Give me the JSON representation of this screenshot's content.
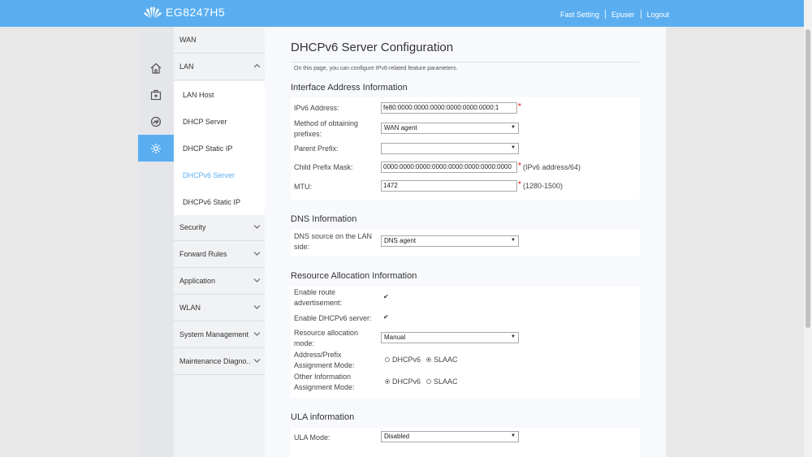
{
  "header": {
    "product": "EG8247H5",
    "fast_setting": "Fast Setting",
    "user": "Epuser",
    "logout": "Logout"
  },
  "sidebar": {
    "icons": [
      "home-icon",
      "medkit-icon",
      "gauge-icon",
      "gear-icon"
    ],
    "menu": [
      {
        "label": "WAN"
      },
      {
        "label": "LAN"
      },
      {
        "label": "Security"
      },
      {
        "label": "Forward Rules"
      },
      {
        "label": "Application"
      },
      {
        "label": "WLAN"
      },
      {
        "label": "System Management"
      },
      {
        "label": "Maintenance Diagno.."
      }
    ],
    "lan_submenu": [
      "LAN Host",
      "DHCP Server",
      "DHCP Static IP",
      "DHCPv6 Server",
      "DHCPv6 Static IP"
    ],
    "active_submenu": "DHCPv6 Server"
  },
  "page": {
    "title": "DHCPv6 Server Configuration",
    "description": "On this page, you can configure IPv6-related feature parameters.",
    "interface": {
      "title": "Interface Address Information",
      "ipv6_label": "IPv6 Address:",
      "ipv6_value": "fe80:0000:0000:0000:0000:0000:0000:1",
      "method_label": "Method of obtaining prefixes:",
      "method_value": "WAN agent",
      "parent_label": "Parent Prefix:",
      "parent_value": "",
      "mask_label": "Child Prefix Mask:",
      "mask_value": "0000:0000:0000:0000:0000:0000:0000:0000",
      "mask_hint": "(IPv6 address/64)",
      "mtu_label": "MTU:",
      "mtu_value": "1472",
      "mtu_hint": "(1280-1500)"
    },
    "dns": {
      "title": "DNS Information",
      "source_label": "DNS source on the LAN side:",
      "source_value": "DNS agent"
    },
    "resource": {
      "title": "Resource Allocation Information",
      "route_label": "Enable route advertisement:",
      "route_checked": true,
      "dhcp_label": "Enable DHCPv6 server:",
      "dhcp_checked": true,
      "mode_label": "Resource allocation mode:",
      "mode_value": "Manual",
      "addr_label": "Address/Prefix Assignment Mode:",
      "other_label": "Other Information Assignment Mode:",
      "opt_dhcpv6": "DHCPv6",
      "opt_slaac": "SLAAC",
      "addr_selected": "SLAAC",
      "other_selected": "DHCPv6"
    },
    "ula": {
      "title": "ULA information",
      "mode_label": "ULA Mode:",
      "mode_value": "Disabled"
    }
  },
  "colors": {
    "accent": "#5aaef0",
    "required": "#ee0000"
  }
}
